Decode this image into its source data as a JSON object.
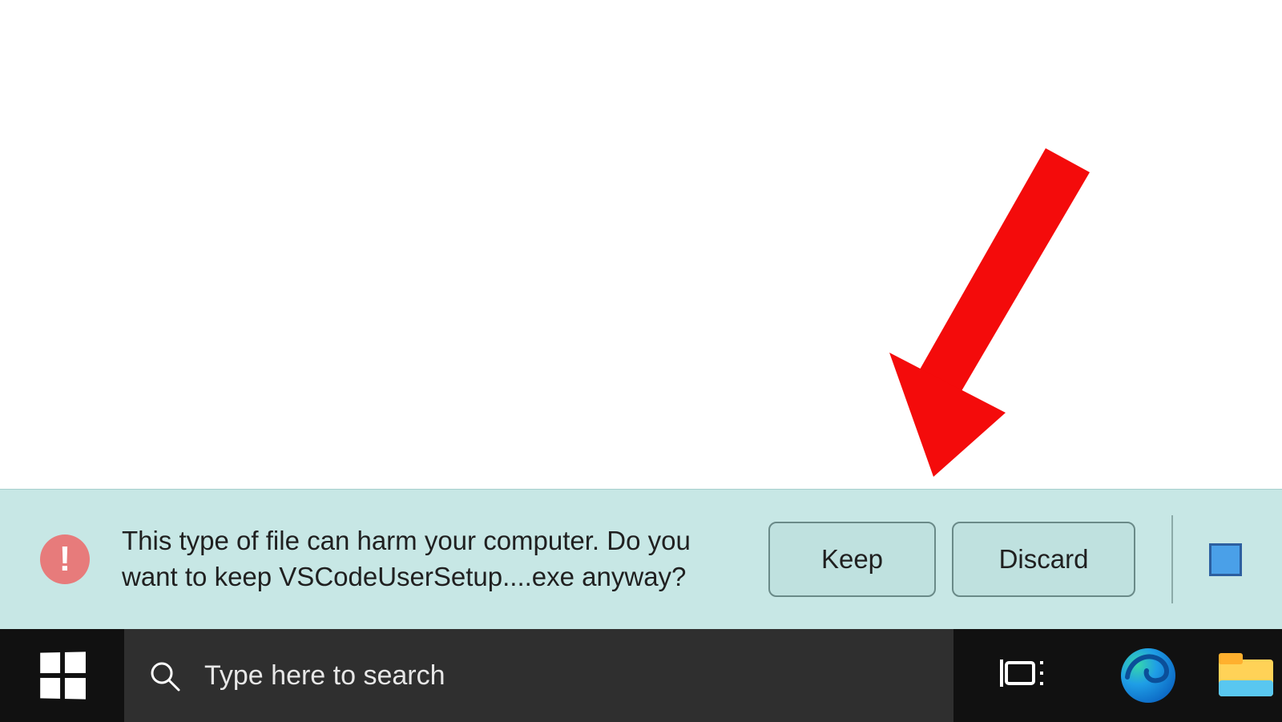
{
  "annotation": {
    "arrow_color": "#f40b0b"
  },
  "download_bar": {
    "warning_glyph": "!",
    "message": "This type of file can harm your computer. Do you want to keep VSCodeUserSetup....exe anyway?",
    "keep_label": "Keep",
    "discard_label": "Discard"
  },
  "taskbar": {
    "search_placeholder": "Type here to search"
  }
}
